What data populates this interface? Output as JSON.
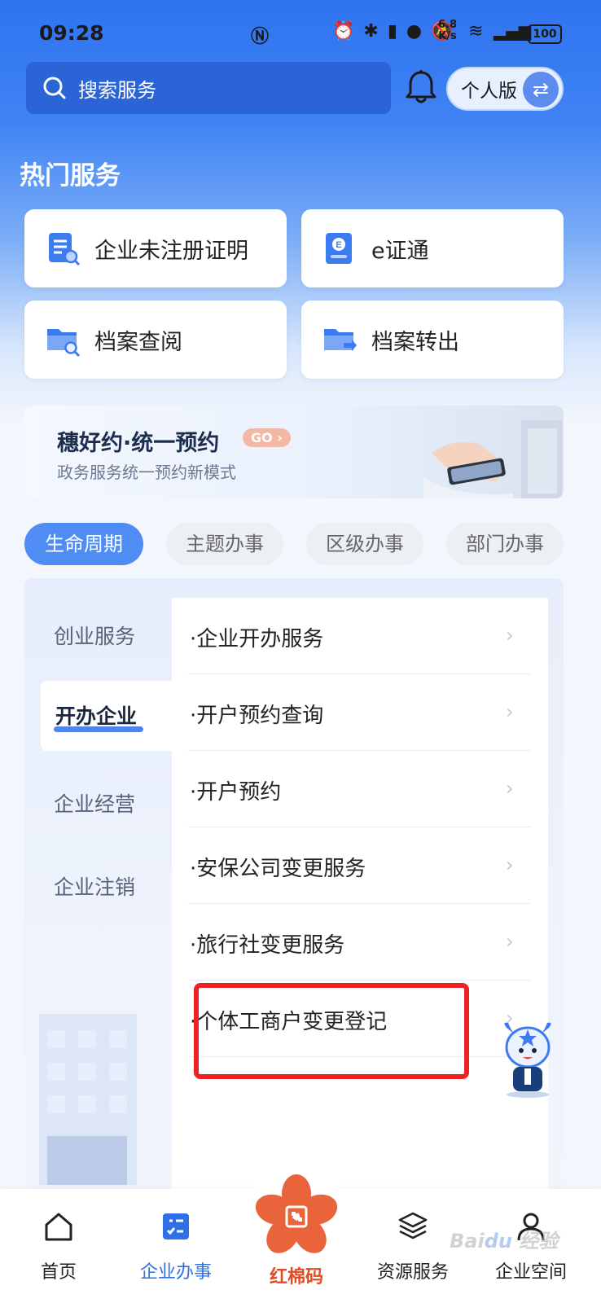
{
  "status_bar": {
    "time": "09:28",
    "speed_top": "6.8",
    "speed_bottom": "K/s",
    "battery": "100"
  },
  "search": {
    "placeholder": "搜索服务"
  },
  "mode_toggle": {
    "label": "个人版"
  },
  "hot_services": {
    "title": "热门服务",
    "items": [
      {
        "label": "企业未注册证明",
        "icon": "document-search-icon"
      },
      {
        "label": "e证通",
        "icon": "id-card-icon"
      },
      {
        "label": "档案查阅",
        "icon": "folder-search-icon"
      },
      {
        "label": "档案转出",
        "icon": "folder-transfer-icon"
      }
    ]
  },
  "banner": {
    "title": "穗好约·统一预约",
    "badge": "GO",
    "subtitle": "政务服务统一预约新模式"
  },
  "tabs": [
    {
      "label": "生命周期",
      "active": true
    },
    {
      "label": "主题办事",
      "active": false
    },
    {
      "label": "区级办事",
      "active": false
    },
    {
      "label": "部门办事",
      "active": false
    }
  ],
  "categories": [
    {
      "label": "创业服务",
      "active": false
    },
    {
      "label": "开办企业",
      "active": true
    },
    {
      "label": "企业经营",
      "active": false
    },
    {
      "label": "企业注销",
      "active": false
    }
  ],
  "services": [
    {
      "label": "·企业开办服务"
    },
    {
      "label": "·开户预约查询"
    },
    {
      "label": "·开户预约"
    },
    {
      "label": "·安保公司变更服务"
    },
    {
      "label": "·旅行社变更服务"
    },
    {
      "label": "·个体工商户变更登记",
      "highlighted": true
    }
  ],
  "bottom_nav": [
    {
      "label": "首页",
      "icon": "home-icon",
      "active": false
    },
    {
      "label": "企业办事",
      "icon": "checklist-icon",
      "active": true
    },
    {
      "label": "红棉码",
      "icon": "kapok-flower-icon",
      "active": false
    },
    {
      "label": "资源服务",
      "icon": "layers-icon",
      "active": false
    },
    {
      "label": "企业空间",
      "icon": "user-icon",
      "active": false
    }
  ],
  "colors": {
    "primary": "#2f6fe8",
    "highlight_box": "#ee2222",
    "center_brand": "#e04c24"
  }
}
